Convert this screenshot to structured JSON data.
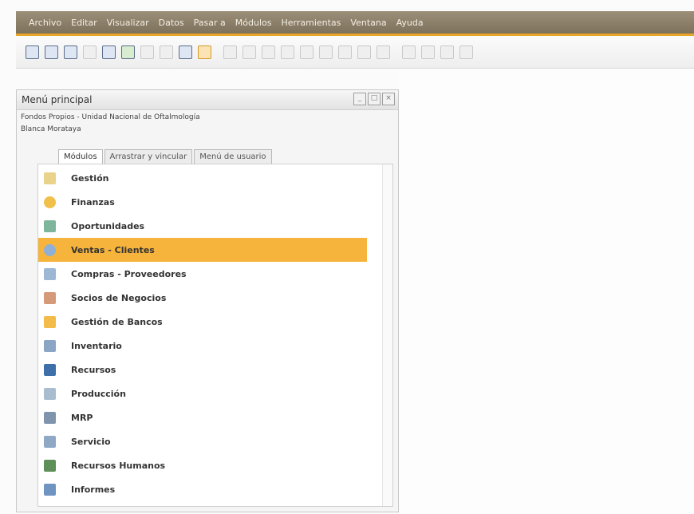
{
  "menubar": {
    "items": [
      "Archivo",
      "Editar",
      "Visualizar",
      "Datos",
      "Pasar a",
      "Módulos",
      "Herramientas",
      "Ventana",
      "Ayuda"
    ]
  },
  "toolbar": {
    "icons": [
      "preview-icon",
      "print-icon",
      "email-icon",
      "export-icon",
      "fax-icon",
      "print-preview-icon",
      "document-icon",
      "document-icon",
      "move-icon",
      "form-icon",
      "find-icon",
      "add-icon",
      "first-record-icon",
      "previous-record-icon",
      "next-record-icon",
      "last-record-icon",
      "filter-icon",
      "sort-icon",
      "settings-icon",
      "copy-icon",
      "paste-icon",
      "layout-icon",
      "layout-icon"
    ]
  },
  "panel": {
    "title": "Menú principal",
    "company": "Fondos Propios - Unidad Nacional de Oftalmología",
    "user": "Blanca Morataya",
    "window_buttons": [
      "_",
      "□",
      "×"
    ],
    "tabs": [
      "Módulos",
      "Arrastrar y vincular",
      "Menú de usuario"
    ],
    "active_tab": "Módulos",
    "selected_item": "Ventas - Clientes",
    "accent": "#f6b43c",
    "items": [
      {
        "label": "Gestión",
        "icon": "management-icon"
      },
      {
        "label": "Finanzas",
        "icon": "finance-icon"
      },
      {
        "label": "Oportunidades",
        "icon": "opportunities-icon"
      },
      {
        "label": "Ventas - Clientes",
        "icon": "sales-icon"
      },
      {
        "label": "Compras - Proveedores",
        "icon": "cart-icon"
      },
      {
        "label": "Socios de Negocios",
        "icon": "partners-icon"
      },
      {
        "label": "Gestión de Bancos",
        "icon": "bank-icon"
      },
      {
        "label": "Inventario",
        "icon": "inventory-icon"
      },
      {
        "label": "Recursos",
        "icon": "resources-icon"
      },
      {
        "label": "Producción",
        "icon": "production-icon"
      },
      {
        "label": "MRP",
        "icon": "mrp-icon"
      },
      {
        "label": "Servicio",
        "icon": "service-icon"
      },
      {
        "label": "Recursos Humanos",
        "icon": "hr-icon"
      },
      {
        "label": "Informes",
        "icon": "reports-icon"
      }
    ]
  }
}
